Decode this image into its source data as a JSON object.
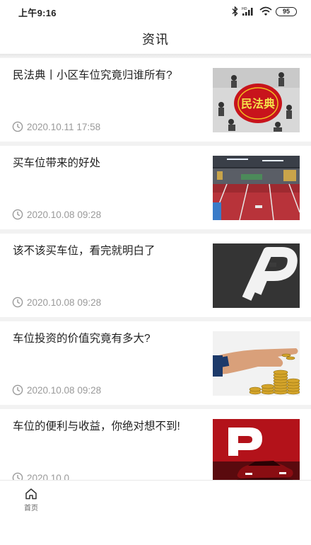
{
  "status_bar": {
    "time": "上午9:16",
    "battery": "95"
  },
  "header": {
    "title": "资讯"
  },
  "news": [
    {
      "title": "民法典丨小区车位究竟归谁所有?",
      "time": "2020.10.11 17:58",
      "thumb_text": "民法典"
    },
    {
      "title": "买车位带来的好处",
      "time": "2020.10.08 09:28"
    },
    {
      "title": "该不该买车位，看完就明白了",
      "time": "2020.10.08 09:28"
    },
    {
      "title": "车位投资的价值究竟有多大?",
      "time": "2020.10.08 09:28"
    },
    {
      "title": "车位的便利与收益，你绝对想不到!",
      "time": "2020.10.0"
    }
  ],
  "tab_bar": {
    "home_label": "首页"
  },
  "colors": {
    "accent_red": "#c8141c",
    "time_gray": "#9a9a9a"
  }
}
